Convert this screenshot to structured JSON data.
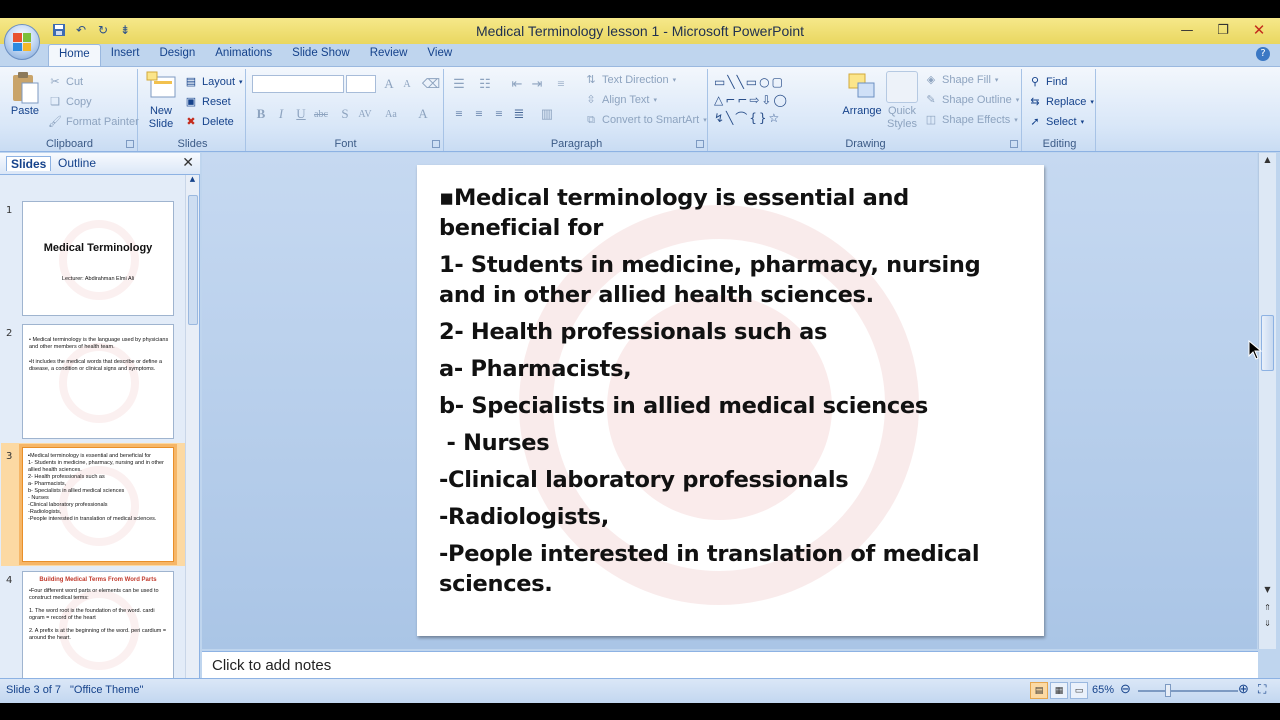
{
  "window": {
    "title": "Medical Terminology lesson 1 - Microsoft PowerPoint",
    "minimize_icon": "minimize-icon",
    "restore_icon": "restore-icon",
    "close_icon": "close-icon"
  },
  "quick_access": [
    "save-icon",
    "undo-icon",
    "redo-icon",
    "customize-icon"
  ],
  "tabs": [
    "Home",
    "Insert",
    "Design",
    "Animations",
    "Slide Show",
    "Review",
    "View"
  ],
  "active_tab": "Home",
  "ribbon": {
    "clipboard": {
      "label": "Clipboard",
      "paste": "Paste",
      "cut": "Cut",
      "copy": "Copy",
      "format_painter": "Format Painter"
    },
    "slides": {
      "label": "Slides",
      "new_slide_line1": "New",
      "new_slide_line2": "Slide",
      "layout": "Layout",
      "reset": "Reset",
      "delete": "Delete"
    },
    "font": {
      "label": "Font"
    },
    "paragraph": {
      "label": "Paragraph",
      "text_direction": "Text Direction",
      "align_text": "Align Text",
      "convert_smartart": "Convert to SmartArt"
    },
    "drawing": {
      "label": "Drawing",
      "arrange": "Arrange",
      "quick_styles_line1": "Quick",
      "quick_styles_line2": "Styles",
      "shape_fill": "Shape Fill",
      "shape_outline": "Shape Outline",
      "shape_effects": "Shape Effects"
    },
    "editing": {
      "label": "Editing",
      "find": "Find",
      "replace": "Replace",
      "select": "Select"
    }
  },
  "left_pane": {
    "tab_slides": "Slides",
    "tab_outline": "Outline",
    "thumbnails": [
      {
        "num": "1",
        "title": "Medical Terminology",
        "subtitle": "Lecturer: Abdirahman Elmi Ali"
      },
      {
        "num": "2",
        "lines": [
          "• Medical terminology is the language used by physicians and other members of health team.",
          "•It includes the medical words that describe or define a disease, a condition or clinical signs and symptoms."
        ]
      },
      {
        "num": "3",
        "lines": [
          "▪Medical terminology is essential and beneficial for",
          "1- Students in medicine, pharmacy, nursing and in other allied health sciences.",
          "2- Health professionals such as",
          "a- Pharmacists,",
          "b- Specialists in allied medical sciences",
          " - Nurses",
          "-Clinical laboratory professionals",
          "-Radiologists,",
          "-People interested in translation of medical sciences."
        ]
      },
      {
        "num": "4",
        "title": "Building Medical Terms From Word Parts",
        "lines": [
          "•Four different word parts or elements can be used to construct medical terms:",
          "1.  The word root is the foundation of the word. cardi ogram = record of the heart",
          "2.  A prefix is at the beginning of the word. peri cardium = around the heart."
        ]
      }
    ]
  },
  "slide": {
    "lines": [
      "▪Medical terminology is essential and beneficial for",
      "1- Students in medicine, pharmacy, nursing and in other allied health sciences.",
      "2- Health professionals such as",
      "a- Pharmacists,",
      "b- Specialists in allied medical sciences",
      " - Nurses",
      "-Clinical laboratory professionals",
      "-Radiologists,",
      "-People interested in translation of medical sciences."
    ]
  },
  "notes_placeholder": "Click to add notes",
  "status": {
    "slide_info": "Slide 3 of 7",
    "theme": "\"Office Theme\"",
    "zoom": "65%"
  },
  "colors": {
    "selected_thumb": "#f6b667",
    "ribbon_blue": "#15428b",
    "title_bar": "#f3e37a"
  }
}
